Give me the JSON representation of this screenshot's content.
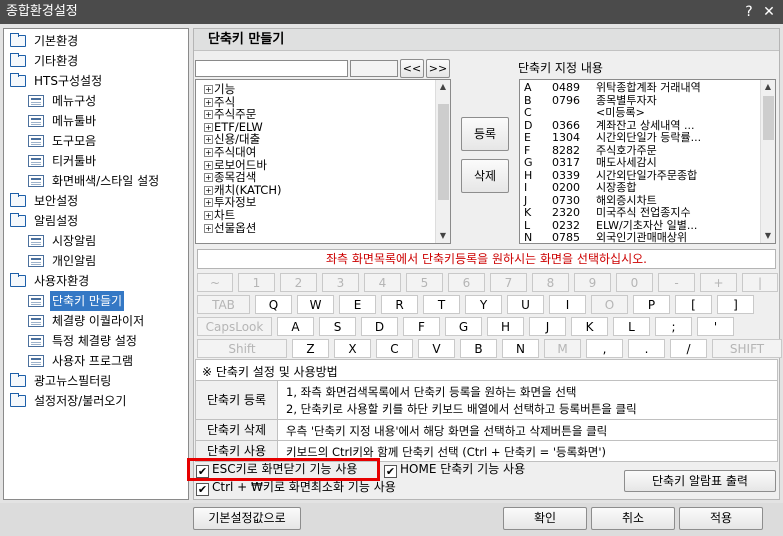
{
  "window": {
    "title": "종합환경설정",
    "help": "?",
    "close": "✕"
  },
  "tree": [
    {
      "label": "기본환경",
      "type": "folder"
    },
    {
      "label": "기타환경",
      "type": "folder"
    },
    {
      "label": "HTS구성설정",
      "type": "folder"
    },
    {
      "label": "메뉴구성",
      "type": "doc"
    },
    {
      "label": "메뉴툴바",
      "type": "doc"
    },
    {
      "label": "도구모음",
      "type": "doc"
    },
    {
      "label": "티커툴바",
      "type": "doc"
    },
    {
      "label": "화면배색/스타일 설정",
      "type": "doc"
    },
    {
      "label": "보안설정",
      "type": "folder"
    },
    {
      "label": "알림설정",
      "type": "folder"
    },
    {
      "label": "시장알림",
      "type": "doc"
    },
    {
      "label": "개인알림",
      "type": "doc"
    },
    {
      "label": "사용자환경",
      "type": "folder"
    },
    {
      "label": "단축키 만들기",
      "type": "doc",
      "selected": true
    },
    {
      "label": "체결량 이퀄라이저",
      "type": "doc"
    },
    {
      "label": "특정 체결량 설정",
      "type": "doc"
    },
    {
      "label": "사용자 프로그램",
      "type": "doc"
    },
    {
      "label": "광고뉴스필터링",
      "type": "folder"
    },
    {
      "label": "설정저장/불러오기",
      "type": "folder"
    }
  ],
  "panel": {
    "title": "단축키 만들기",
    "search_value": "",
    "prev": "<<",
    "next": ">>",
    "assigned_title": "단축키 지정 내용",
    "register": "등록",
    "delete": "삭제"
  },
  "menu_list": [
    "기능",
    "주식",
    "주식주문",
    "ETF/ELW",
    "신용/대출",
    "주식대여",
    "로보어드바",
    "종목검색",
    "캐치(KATCH)",
    "투자정보",
    "차트",
    "선물옵션"
  ],
  "shortcuts": [
    {
      "key": "A",
      "code": "0489",
      "name": "위탁종합계좌 거래내역"
    },
    {
      "key": "B",
      "code": "0796",
      "name": "종목별투자자"
    },
    {
      "key": "C",
      "code": "",
      "name": "<미등록>"
    },
    {
      "key": "D",
      "code": "0366",
      "name": "계좌잔고 상세내역 ..."
    },
    {
      "key": "E",
      "code": "1304",
      "name": "시간외단일가 등락률..."
    },
    {
      "key": "F",
      "code": "8282",
      "name": "주식호가주문"
    },
    {
      "key": "G",
      "code": "0317",
      "name": "매도사세감시"
    },
    {
      "key": "H",
      "code": "0339",
      "name": "시간외단일가주문종합"
    },
    {
      "key": "I",
      "code": "0200",
      "name": "시장종합"
    },
    {
      "key": "J",
      "code": "0730",
      "name": "해외증시차트"
    },
    {
      "key": "K",
      "code": "2320",
      "name": "미국주식 전업종지수"
    },
    {
      "key": "L",
      "code": "0232",
      "name": "ELW/기초자산 일별..."
    },
    {
      "key": "N",
      "code": "0785",
      "name": "외국인기관매매상위"
    }
  ],
  "notice": "좌측 화면목록에서 단축키등록을 원하시는 화면을 선택하십시오.",
  "keyboard": [
    [
      "~",
      "1",
      "2",
      "3",
      "4",
      "5",
      "6",
      "7",
      "8",
      "9",
      "0",
      "-",
      "+",
      "|"
    ],
    [
      "TAB",
      "Q",
      "W",
      "E",
      "R",
      "T",
      "Y",
      "U",
      "I",
      "O",
      "P",
      "[",
      "]"
    ],
    [
      "CapsLook",
      "A",
      "S",
      "D",
      "F",
      "G",
      "H",
      "J",
      "K",
      "L",
      ";",
      "'"
    ],
    [
      "Shift",
      "Z",
      "X",
      "C",
      "V",
      "B",
      "N",
      "M",
      ",",
      ".",
      "/",
      "SHIFT"
    ]
  ],
  "usage": {
    "header": "※ 단축키 설정 및 사용방법",
    "register_label": "단축키 등록",
    "register_line1": "1, 좌측 화면검색목록에서 단축키 등록을 원하는 화면을 선택",
    "register_line2": "2, 단축키로 사용할 키를 하단 키보드 배열에서 선택하고 등록버튼을 클릭",
    "delete_label": "단축키 삭제",
    "delete_text": "우측 '단축키 지정 내용'에서 해당 화면을 선택하고 삭제버튼을 클릭",
    "use_label": "단축키 사용",
    "use_text": "키보드의 Ctrl키와 함께 단축키 선택 (Ctrl + 단축키 = '등록화면')"
  },
  "options": {
    "esc": "ESC키로 화면닫기 기능 사용",
    "home": "HOME 단축키 기능 사용",
    "ctrl": "Ctrl + ₩키로 화면최소화 기능 사용",
    "print": "단축키 알람표 출력"
  },
  "footer": {
    "defaults": "기본설정값으로",
    "ok": "확인",
    "cancel": "취소",
    "apply": "적용"
  }
}
